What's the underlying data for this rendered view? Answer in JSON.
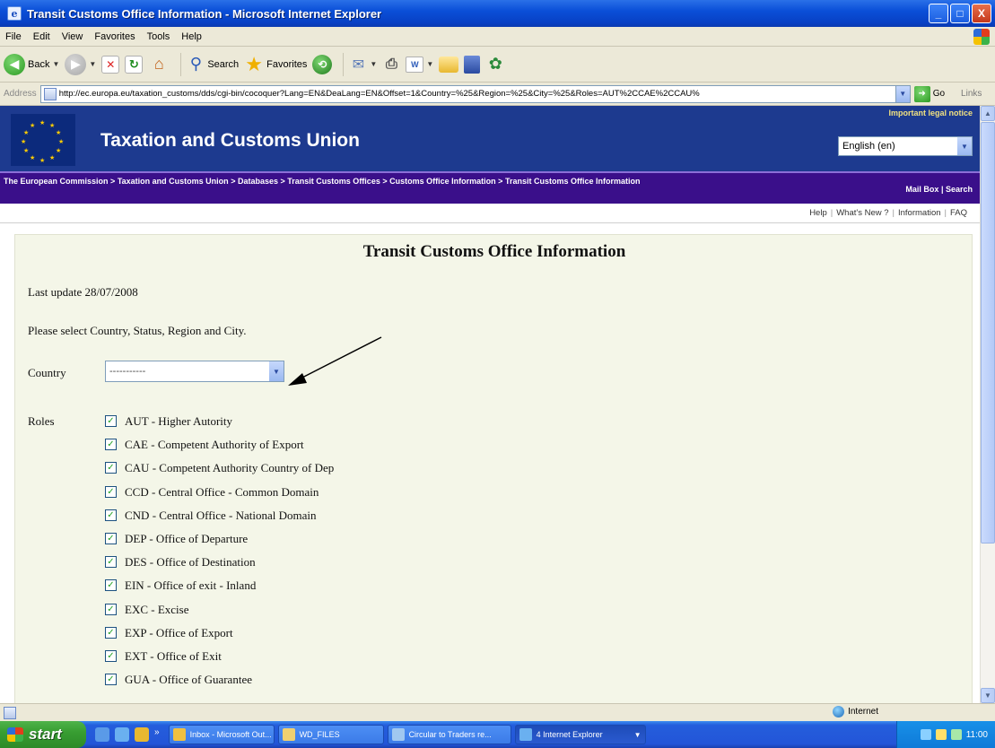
{
  "window": {
    "title": "Transit Customs Office Information - Microsoft Internet Explorer",
    "btn_min": "_",
    "btn_max": "□",
    "btn_close": "X"
  },
  "menu": [
    "File",
    "Edit",
    "View",
    "Favorites",
    "Tools",
    "Help"
  ],
  "toolbar": {
    "back": "Back",
    "search": "Search",
    "favorites": "Favorites"
  },
  "address": {
    "label": "Address",
    "url": "http://ec.europa.eu/taxation_customs/dds/cgi-bin/cocoquer?Lang=EN&DeaLang=EN&Offset=1&Country=%25&Region=%25&City=%25&Roles=AUT%2CCAE%2CCAU%",
    "go": "Go",
    "links": "Links"
  },
  "eu": {
    "title": "Taxation and Customs Union",
    "legal_notice": "Important legal notice",
    "language": "English (en)"
  },
  "breadcrumb": {
    "items": [
      "The European Commission",
      "Taxation and Customs Union",
      "Databases",
      "Transit Customs Offices",
      "Customs Office Information",
      "Transit Customs Office Information"
    ],
    "separator": ">",
    "mailbox": "Mail Box",
    "search": "Search"
  },
  "help_links": [
    "Help",
    "What's New ?",
    "Information",
    "FAQ"
  ],
  "content": {
    "title": "Transit Customs Office Information",
    "last_update": "Last update 28/07/2008",
    "instruction": "Please select Country, Status, Region and City.",
    "country_label": "Country",
    "country_value": "-----------",
    "roles_label": "Roles",
    "roles": [
      "AUT - Higher Autority",
      "CAE - Competent Authority of Export",
      "CAU - Competent Authority Country of Dep",
      "CCD - Central Office - Common Domain",
      "CND - Central Office - National Domain",
      "DEP - Office of Departure",
      "DES - Office of Destination",
      "EIN - Office of exit - Inland",
      "EXC - Excise",
      "EXP - Office of Export",
      "EXT - Office of Exit",
      "GUA - Office of Guarantee"
    ]
  },
  "status": {
    "zone": "Internet"
  },
  "taskbar": {
    "start": "start",
    "tasks": [
      "Inbox - Microsoft Out...",
      "WD_FILES",
      "Circular to Traders re...",
      "4 Internet Explorer"
    ],
    "clock": "11:00"
  }
}
